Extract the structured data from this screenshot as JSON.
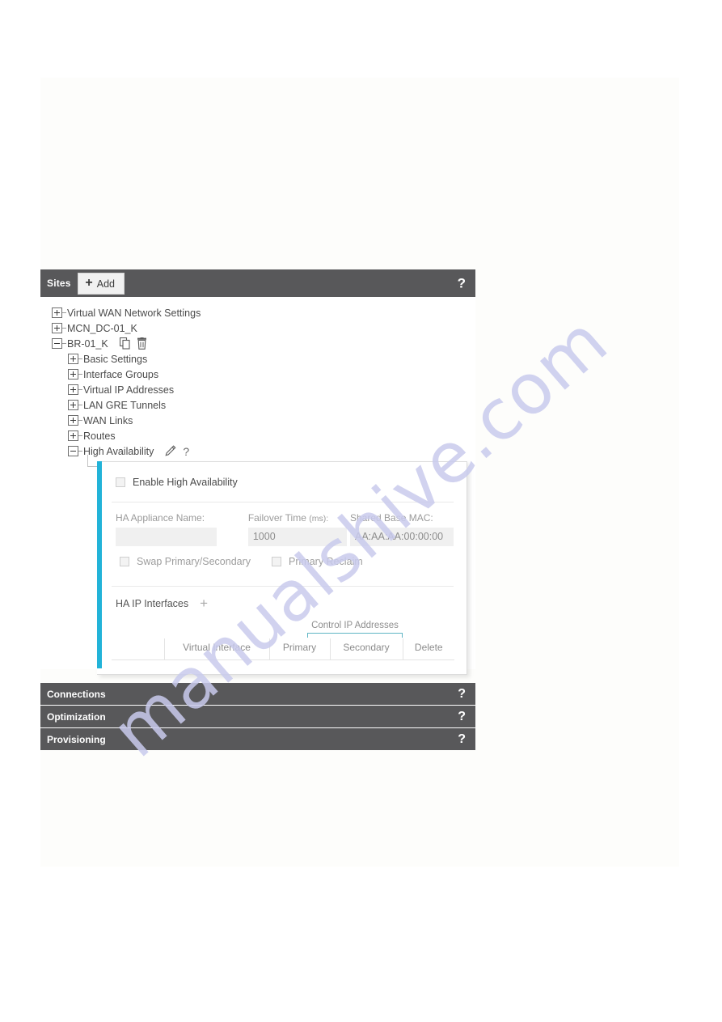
{
  "watermark": {
    "text": "manualshive.com"
  },
  "sites_panel": {
    "title": "Sites",
    "add_label": "Add",
    "add_icon": "plus-icon",
    "help_label": "?",
    "tree": [
      {
        "label": "Virtual WAN Network Settings",
        "state": "collapsed",
        "level": 0
      },
      {
        "label": "MCN_DC-01_K",
        "state": "collapsed",
        "level": 0
      },
      {
        "label": "BR-01_K",
        "state": "expanded",
        "level": 0,
        "icons": [
          "clone-icon",
          "trash-icon"
        ]
      },
      {
        "label": "Basic Settings",
        "state": "collapsed",
        "level": 1
      },
      {
        "label": "Interface Groups",
        "state": "collapsed",
        "level": 1
      },
      {
        "label": "Virtual IP Addresses",
        "state": "collapsed",
        "level": 1
      },
      {
        "label": "LAN GRE Tunnels",
        "state": "collapsed",
        "level": 1
      },
      {
        "label": "WAN Links",
        "state": "collapsed",
        "level": 1
      },
      {
        "label": "Routes",
        "state": "collapsed",
        "level": 1
      },
      {
        "label": "High Availability",
        "state": "expanded",
        "level": 1,
        "icons": [
          "pencil-icon",
          "help-icon"
        ]
      }
    ]
  },
  "ha_form": {
    "accent_color": "#22b3d8",
    "enable": {
      "label": "Enable High Availability",
      "checked": false
    },
    "appliance_name": {
      "label": "HA Appliance Name:",
      "value": "",
      "placeholder": ""
    },
    "failover_time": {
      "label": "Failover Time",
      "unit": "(ms):",
      "value": "1000"
    },
    "shared_base_mac": {
      "label": "Shared Base MAC:",
      "value": "AA:AA:AA:00:00:00"
    },
    "swap_primary_secondary": {
      "label": "Swap Primary/Secondary",
      "checked": false
    },
    "primary_reclaim": {
      "label": "Primary Reclaim",
      "checked": false
    },
    "ha_ip_interfaces": {
      "title": "HA IP Interfaces",
      "add_icon": "plus-icon",
      "group_header": "Control IP Addresses",
      "columns": [
        "",
        "Virtual Interface",
        "Primary",
        "Secondary",
        "Delete"
      ],
      "rows": []
    }
  },
  "sections": [
    {
      "label": "Connections",
      "help": "?"
    },
    {
      "label": "Optimization",
      "help": "?"
    },
    {
      "label": "Provisioning",
      "help": "?"
    }
  ]
}
